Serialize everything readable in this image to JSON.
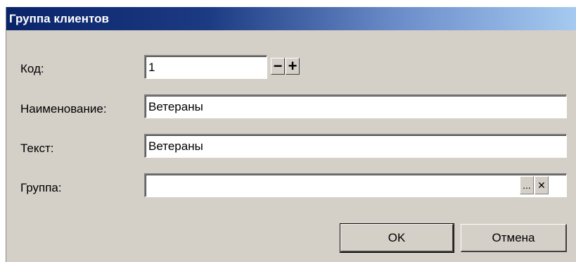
{
  "dialog": {
    "title": "Группа клиентов"
  },
  "fields": {
    "code": {
      "label": "Код:",
      "value": "1"
    },
    "name": {
      "label": "Наименование:",
      "value": "Ветераны"
    },
    "text": {
      "label": "Текст:",
      "value": "Ветераны"
    },
    "group": {
      "label": "Группа:",
      "value": ""
    }
  },
  "spinner": {
    "minus": "−",
    "plus": "+"
  },
  "group_buttons": {
    "browse": "...",
    "clear": "✕"
  },
  "buttons": {
    "ok": "OK",
    "cancel": "Отмена"
  },
  "colors": {
    "face": "#d4d0c8",
    "title_start": "#0a246a",
    "title_end": "#a6caf0"
  }
}
